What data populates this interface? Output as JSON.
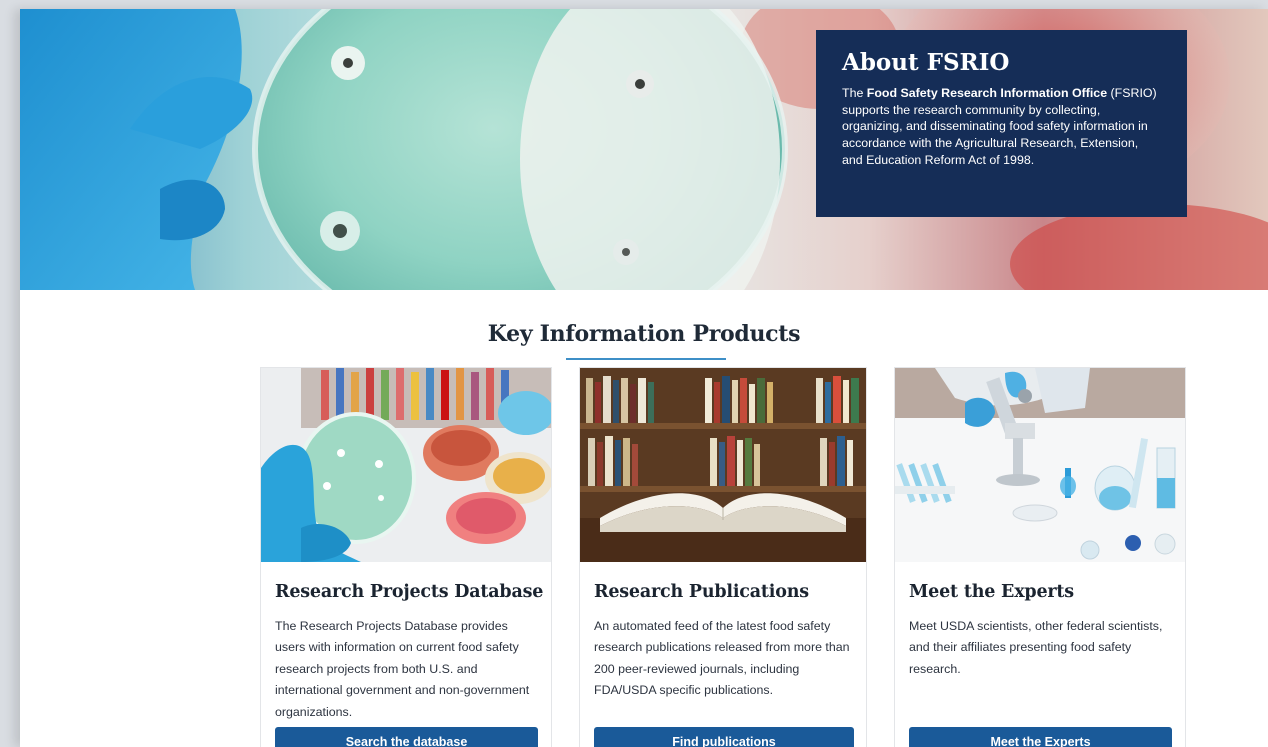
{
  "hero": {
    "about_title": "About FSRIO",
    "about_text_prefix": "The ",
    "about_text_bold": "Food Safety Research Information Office",
    "about_text_suffix": " (FSRIO) supports the research community by collecting, organizing, and disseminating food safety information in accordance with the Agricultural Research, Extension, and Education Reform Act of 1998."
  },
  "section": {
    "title": "Key Information Products"
  },
  "cards": [
    {
      "title": "Research Projects Database",
      "text": "The Research Projects Database provides users with information on current food safety research projects from both U.S. and international government and non-government organizations.",
      "button": "Search the database",
      "image": "petri-dish-photo"
    },
    {
      "title": "Research Publications",
      "text": "An automated feed of the latest food safety research publications released from more than 200 peer-reviewed journals, including FDA/USDA specific publications.",
      "button": "Find publications",
      "image": "open-book-library-photo"
    },
    {
      "title": "Meet the Experts",
      "text": "Meet USDA scientists, other federal scientists, and their affiliates presenting food safety research.",
      "button": "Meet the Experts",
      "image": "lab-microscope-photo"
    }
  ]
}
